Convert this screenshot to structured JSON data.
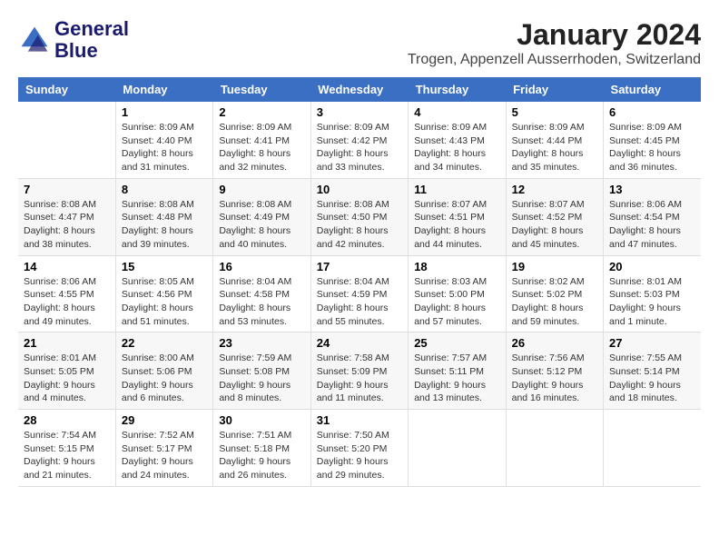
{
  "logo": {
    "line1": "General",
    "line2": "Blue"
  },
  "title": "January 2024",
  "subtitle": "Trogen, Appenzell Ausserrhoden, Switzerland",
  "days_of_week": [
    "Sunday",
    "Monday",
    "Tuesday",
    "Wednesday",
    "Thursday",
    "Friday",
    "Saturday"
  ],
  "weeks": [
    [
      {
        "num": "",
        "detail": ""
      },
      {
        "num": "1",
        "detail": "Sunrise: 8:09 AM\nSunset: 4:40 PM\nDaylight: 8 hours\nand 31 minutes."
      },
      {
        "num": "2",
        "detail": "Sunrise: 8:09 AM\nSunset: 4:41 PM\nDaylight: 8 hours\nand 32 minutes."
      },
      {
        "num": "3",
        "detail": "Sunrise: 8:09 AM\nSunset: 4:42 PM\nDaylight: 8 hours\nand 33 minutes."
      },
      {
        "num": "4",
        "detail": "Sunrise: 8:09 AM\nSunset: 4:43 PM\nDaylight: 8 hours\nand 34 minutes."
      },
      {
        "num": "5",
        "detail": "Sunrise: 8:09 AM\nSunset: 4:44 PM\nDaylight: 8 hours\nand 35 minutes."
      },
      {
        "num": "6",
        "detail": "Sunrise: 8:09 AM\nSunset: 4:45 PM\nDaylight: 8 hours\nand 36 minutes."
      }
    ],
    [
      {
        "num": "7",
        "detail": "Sunrise: 8:08 AM\nSunset: 4:47 PM\nDaylight: 8 hours\nand 38 minutes."
      },
      {
        "num": "8",
        "detail": "Sunrise: 8:08 AM\nSunset: 4:48 PM\nDaylight: 8 hours\nand 39 minutes."
      },
      {
        "num": "9",
        "detail": "Sunrise: 8:08 AM\nSunset: 4:49 PM\nDaylight: 8 hours\nand 40 minutes."
      },
      {
        "num": "10",
        "detail": "Sunrise: 8:08 AM\nSunset: 4:50 PM\nDaylight: 8 hours\nand 42 minutes."
      },
      {
        "num": "11",
        "detail": "Sunrise: 8:07 AM\nSunset: 4:51 PM\nDaylight: 8 hours\nand 44 minutes."
      },
      {
        "num": "12",
        "detail": "Sunrise: 8:07 AM\nSunset: 4:52 PM\nDaylight: 8 hours\nand 45 minutes."
      },
      {
        "num": "13",
        "detail": "Sunrise: 8:06 AM\nSunset: 4:54 PM\nDaylight: 8 hours\nand 47 minutes."
      }
    ],
    [
      {
        "num": "14",
        "detail": "Sunrise: 8:06 AM\nSunset: 4:55 PM\nDaylight: 8 hours\nand 49 minutes."
      },
      {
        "num": "15",
        "detail": "Sunrise: 8:05 AM\nSunset: 4:56 PM\nDaylight: 8 hours\nand 51 minutes."
      },
      {
        "num": "16",
        "detail": "Sunrise: 8:04 AM\nSunset: 4:58 PM\nDaylight: 8 hours\nand 53 minutes."
      },
      {
        "num": "17",
        "detail": "Sunrise: 8:04 AM\nSunset: 4:59 PM\nDaylight: 8 hours\nand 55 minutes."
      },
      {
        "num": "18",
        "detail": "Sunrise: 8:03 AM\nSunset: 5:00 PM\nDaylight: 8 hours\nand 57 minutes."
      },
      {
        "num": "19",
        "detail": "Sunrise: 8:02 AM\nSunset: 5:02 PM\nDaylight: 8 hours\nand 59 minutes."
      },
      {
        "num": "20",
        "detail": "Sunrise: 8:01 AM\nSunset: 5:03 PM\nDaylight: 9 hours\nand 1 minute."
      }
    ],
    [
      {
        "num": "21",
        "detail": "Sunrise: 8:01 AM\nSunset: 5:05 PM\nDaylight: 9 hours\nand 4 minutes."
      },
      {
        "num": "22",
        "detail": "Sunrise: 8:00 AM\nSunset: 5:06 PM\nDaylight: 9 hours\nand 6 minutes."
      },
      {
        "num": "23",
        "detail": "Sunrise: 7:59 AM\nSunset: 5:08 PM\nDaylight: 9 hours\nand 8 minutes."
      },
      {
        "num": "24",
        "detail": "Sunrise: 7:58 AM\nSunset: 5:09 PM\nDaylight: 9 hours\nand 11 minutes."
      },
      {
        "num": "25",
        "detail": "Sunrise: 7:57 AM\nSunset: 5:11 PM\nDaylight: 9 hours\nand 13 minutes."
      },
      {
        "num": "26",
        "detail": "Sunrise: 7:56 AM\nSunset: 5:12 PM\nDaylight: 9 hours\nand 16 minutes."
      },
      {
        "num": "27",
        "detail": "Sunrise: 7:55 AM\nSunset: 5:14 PM\nDaylight: 9 hours\nand 18 minutes."
      }
    ],
    [
      {
        "num": "28",
        "detail": "Sunrise: 7:54 AM\nSunset: 5:15 PM\nDaylight: 9 hours\nand 21 minutes."
      },
      {
        "num": "29",
        "detail": "Sunrise: 7:52 AM\nSunset: 5:17 PM\nDaylight: 9 hours\nand 24 minutes."
      },
      {
        "num": "30",
        "detail": "Sunrise: 7:51 AM\nSunset: 5:18 PM\nDaylight: 9 hours\nand 26 minutes."
      },
      {
        "num": "31",
        "detail": "Sunrise: 7:50 AM\nSunset: 5:20 PM\nDaylight: 9 hours\nand 29 minutes."
      },
      {
        "num": "",
        "detail": ""
      },
      {
        "num": "",
        "detail": ""
      },
      {
        "num": "",
        "detail": ""
      }
    ]
  ]
}
